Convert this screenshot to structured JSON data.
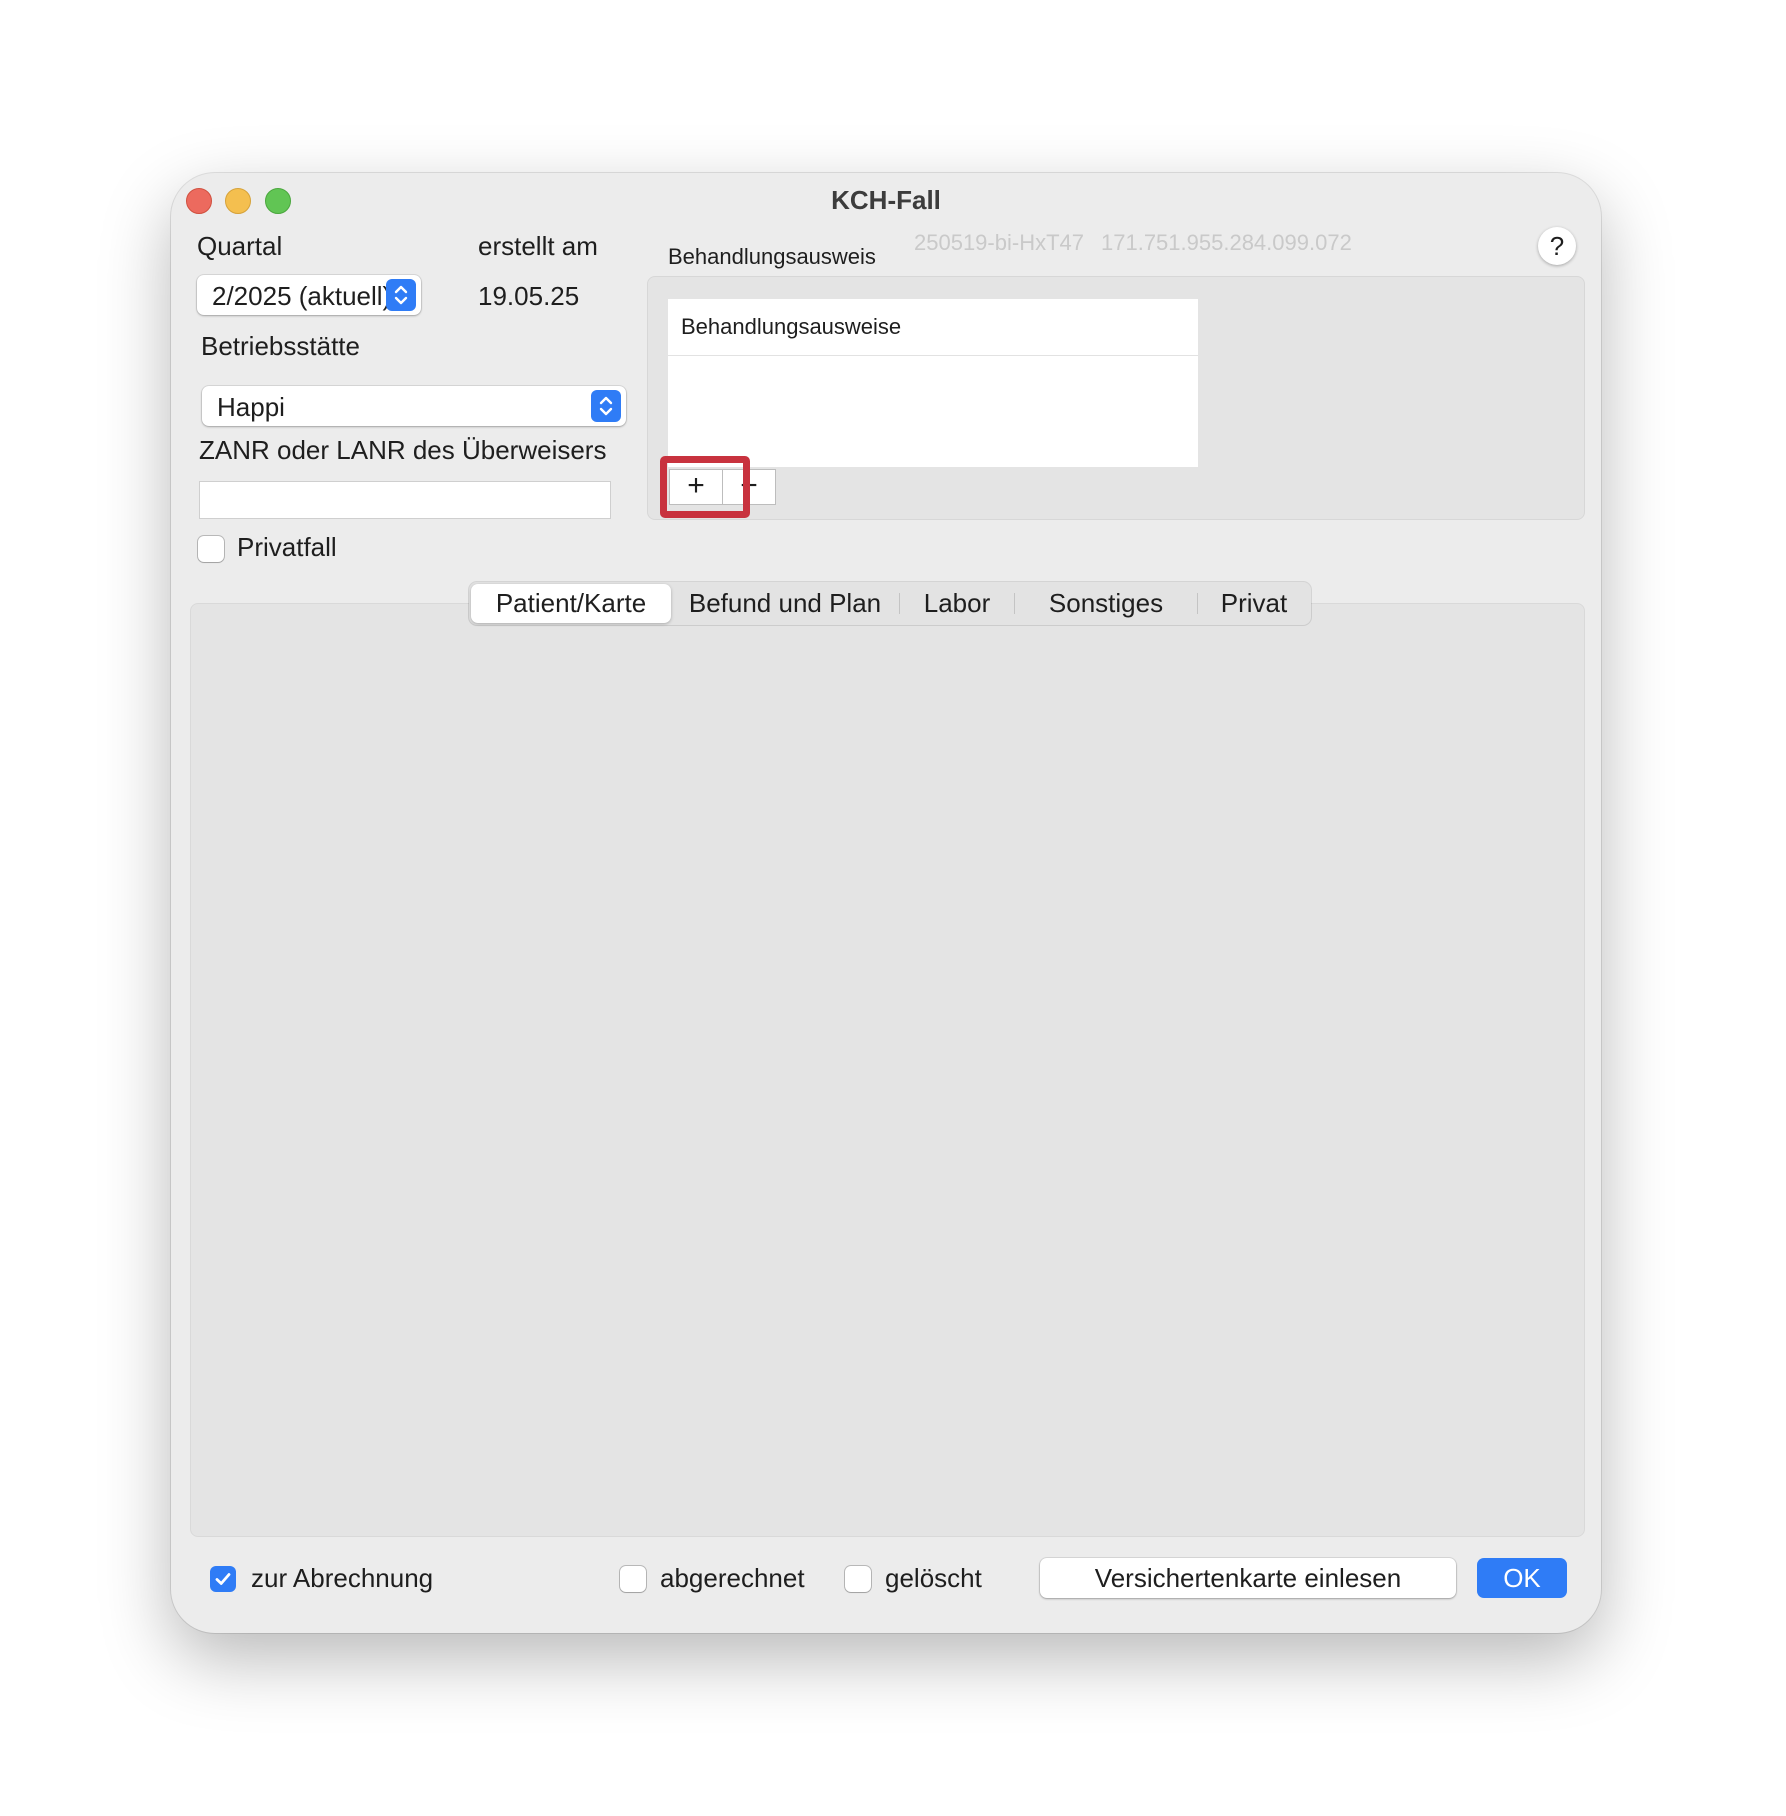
{
  "window": {
    "title": "KCH-Fall",
    "meta_id": "250519-bi-HxT47",
    "meta_number": "171.751.955.284.099.072",
    "help_label": "?"
  },
  "quartal": {
    "label": "Quartal",
    "value": "2/2025 (aktuell)"
  },
  "erstellt": {
    "label": "erstellt am",
    "value": "19.05.25"
  },
  "betriebsstaette": {
    "label": "Betriebsstätte",
    "value": "Happi"
  },
  "ueberweiser": {
    "label": "ZANR oder LANR des Überweisers",
    "value": ""
  },
  "privatfall": {
    "label": "Privatfall",
    "checked": false
  },
  "behandlungsausweis": {
    "group_label": "Behandlungsausweis",
    "column_header": "Behandlungsausweise",
    "rows": [],
    "add_label": "+",
    "remove_label": "−"
  },
  "tabs": [
    {
      "label": "Patient/Karte",
      "active": true
    },
    {
      "label": "Befund und Plan",
      "active": false
    },
    {
      "label": "Labor",
      "active": false
    },
    {
      "label": "Sonstiges",
      "active": false
    },
    {
      "label": "Privat",
      "active": false
    }
  ],
  "footer": {
    "zur_abrechnung": {
      "label": "zur Abrechnung",
      "checked": true
    },
    "abgerechnet": {
      "label": "abgerechnet",
      "checked": false
    },
    "geloescht": {
      "label": "gelöscht",
      "checked": false
    },
    "versichertenkarte_label": "Versichertenkarte einlesen",
    "ok_label": "OK"
  },
  "colors": {
    "accent": "#2f7cf6",
    "highlight": "#c8323e",
    "window_bg": "#ececec",
    "panel_bg": "#e4e4e4"
  },
  "icons": {
    "close": "traffic-close-icon",
    "minimize": "traffic-minimize-icon",
    "maximize": "traffic-maximize-icon",
    "stepper": "chevron-up-down-icon",
    "checkmark": "checkmark-icon"
  }
}
